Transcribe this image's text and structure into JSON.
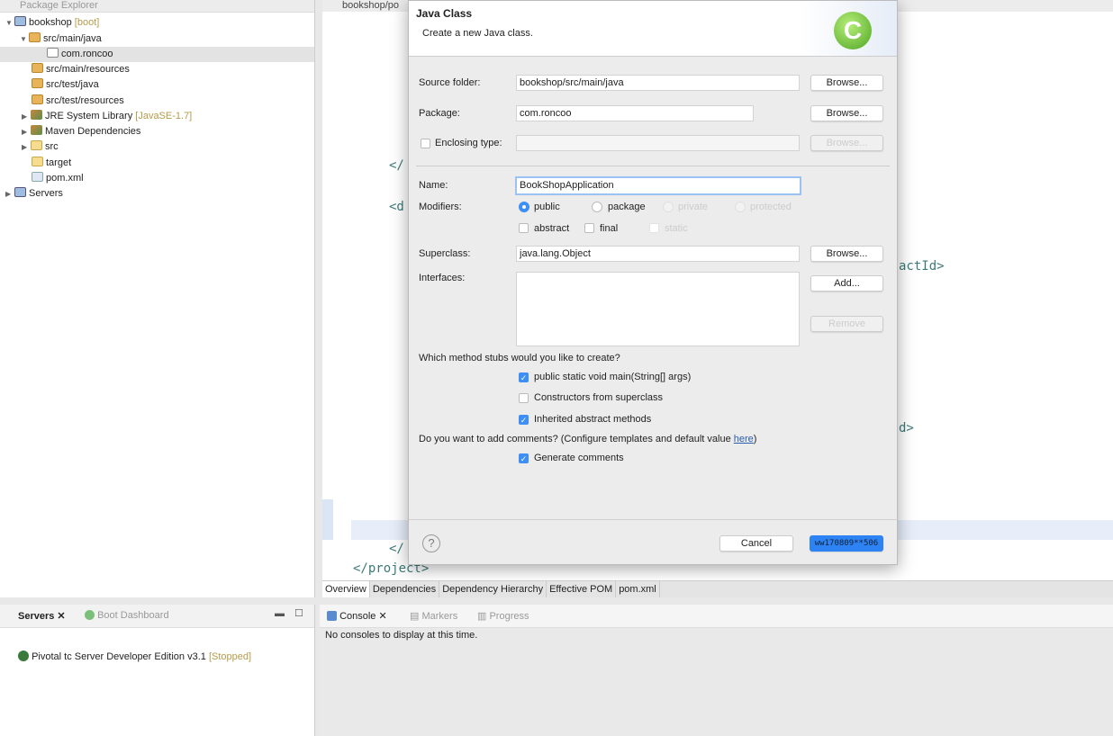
{
  "explorer": {
    "tab": "Package Explorer",
    "items": [
      {
        "label": "bookshop",
        "decor": "[boot]",
        "icon": "project-icon"
      },
      {
        "label": "src/main/java",
        "icon": "source-folder-icon"
      },
      {
        "label": "com.roncoo",
        "icon": "package-icon"
      },
      {
        "label": "src/main/resources",
        "icon": "source-folder-icon"
      },
      {
        "label": "src/test/java",
        "icon": "source-folder-icon"
      },
      {
        "label": "src/test/resources",
        "icon": "source-folder-icon"
      },
      {
        "label": "JRE System Library",
        "decor": "[JavaSE-1.7]",
        "icon": "library-icon"
      },
      {
        "label": "Maven Dependencies",
        "icon": "library-icon"
      },
      {
        "label": "src",
        "icon": "folder-icon"
      },
      {
        "label": "target",
        "icon": "folder-icon"
      },
      {
        "label": "pom.xml",
        "icon": "xml-file-icon"
      },
      {
        "label": "Servers",
        "icon": "folder-icon"
      }
    ]
  },
  "editor": {
    "tab": "bookshop/po",
    "code": [
      "</",
      "<d",
      "actId>",
      "d>",
      "</",
      "</project>"
    ]
  },
  "dialog": {
    "title": "Java Class",
    "subtitle": "Create a new Java class.",
    "source_folder_label": "Source folder:",
    "source_folder": "bookshop/src/main/java",
    "package_label": "Package:",
    "package": "com.roncoo",
    "enclosing_label": "Enclosing type:",
    "enclosing": "",
    "browse": "Browse...",
    "name_label": "Name:",
    "name": "BookShopApplication",
    "modifiers_label": "Modifiers:",
    "modifiers": [
      "public",
      "package",
      "private",
      "protected"
    ],
    "modifiers2": [
      "abstract",
      "final",
      "static"
    ],
    "superclass_label": "Superclass:",
    "superclass": "java.lang.Object",
    "interfaces_label": "Interfaces:",
    "add": "Add...",
    "remove": "Remove",
    "stubs_q": "Which method stubs would you like to create?",
    "stubs": [
      {
        "label": "public static void main(String[] args)",
        "checked": true
      },
      {
        "label": "Constructors from superclass",
        "checked": false
      },
      {
        "label": "Inherited abstract methods",
        "checked": true
      }
    ],
    "comments_q": "Do you want to add comments? (Configure templates and default value ",
    "comments_link": "here",
    "comments_end": ")",
    "gen_comments": "Generate comments",
    "cancel": "Cancel",
    "finish_overlay": "ww170809**506"
  },
  "pom_tabs": [
    "Overview",
    "Dependencies",
    "Dependency Hierarchy",
    "Effective POM",
    "pom.xml"
  ],
  "servers": {
    "tabs": [
      "Servers",
      "Boot Dashboard"
    ],
    "item": "Pivotal tc Server Developer Edition v3.1",
    "status": "[Stopped]"
  },
  "console": {
    "tabs": [
      "Console",
      "Markers",
      "Progress"
    ],
    "message": "No consoles to display at this time."
  }
}
